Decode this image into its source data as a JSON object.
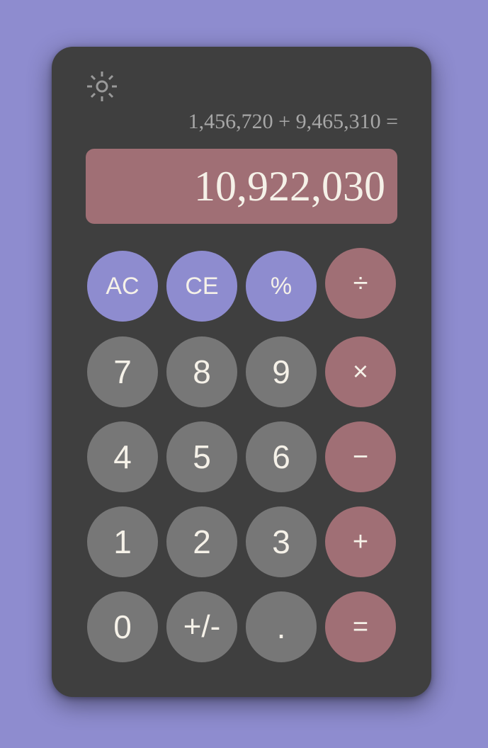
{
  "theme_toggle": {
    "icon": "sun-icon"
  },
  "expression": "1,456,720 + 9,465,310 =",
  "display": {
    "value": "10,922,030"
  },
  "colors": {
    "background": "#8e8ccf",
    "body": "#3f3f3f",
    "display": "#a06f75",
    "number_key": "#777777",
    "function_key": "#8e8ccf",
    "operator_key": "#a06f75",
    "text": "#f5f1e8",
    "expression_text": "#a7a7a7"
  },
  "keys": {
    "ac": "AC",
    "ce": "CE",
    "percent": "%",
    "divide": "÷",
    "seven": "7",
    "eight": "8",
    "nine": "9",
    "multiply": "×",
    "four": "4",
    "five": "5",
    "six": "6",
    "subtract": "−",
    "one": "1",
    "two": "2",
    "three": "3",
    "add": "+",
    "zero": "0",
    "negate": "+/-",
    "decimal": ".",
    "equals": "="
  }
}
